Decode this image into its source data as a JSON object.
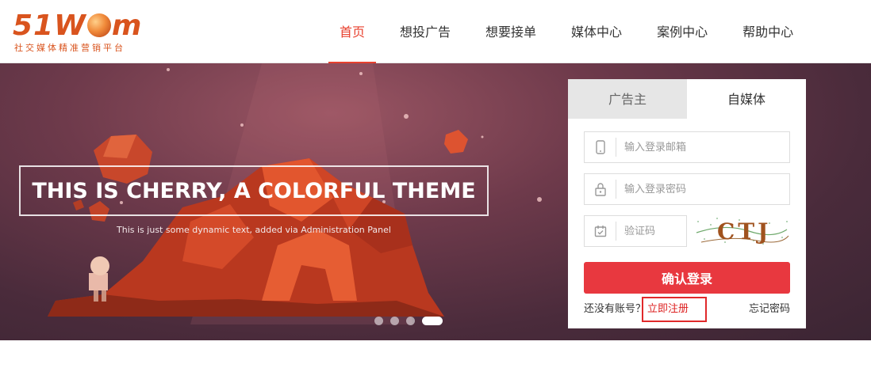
{
  "logo": {
    "main_left": "51W",
    "main_right": "m",
    "subtitle": "社交媒体精准营销平台"
  },
  "nav": {
    "items": [
      {
        "label": "首页",
        "active": true
      },
      {
        "label": "想投广告",
        "active": false
      },
      {
        "label": "想要接单",
        "active": false
      },
      {
        "label": "媒体中心",
        "active": false
      },
      {
        "label": "案例中心",
        "active": false
      },
      {
        "label": "帮助中心",
        "active": false
      }
    ]
  },
  "hero": {
    "title": "THIS IS CHERRY, A COLORFUL THEME",
    "subtitle": "This is just some dynamic text, added via Administration Panel",
    "slides_count": 4,
    "active_slide": 4
  },
  "login": {
    "tabs": [
      {
        "label": "广告主",
        "active": false
      },
      {
        "label": "自媒体",
        "active": true
      }
    ],
    "email_placeholder": "输入登录邮箱",
    "password_placeholder": "输入登录密码",
    "captcha_placeholder": "验证码",
    "captcha_text": "CTJ",
    "submit_label": "确认登录",
    "no_account_text": "还没有账号？",
    "register_label": "立即注册",
    "forgot_label": "忘记密码",
    "icons": {
      "email": "phone-icon",
      "password": "lock-icon",
      "captcha": "calendar-icon"
    }
  },
  "colors": {
    "accent": "#e8402e",
    "button": "#e8383f",
    "logo": "#d9541e"
  }
}
